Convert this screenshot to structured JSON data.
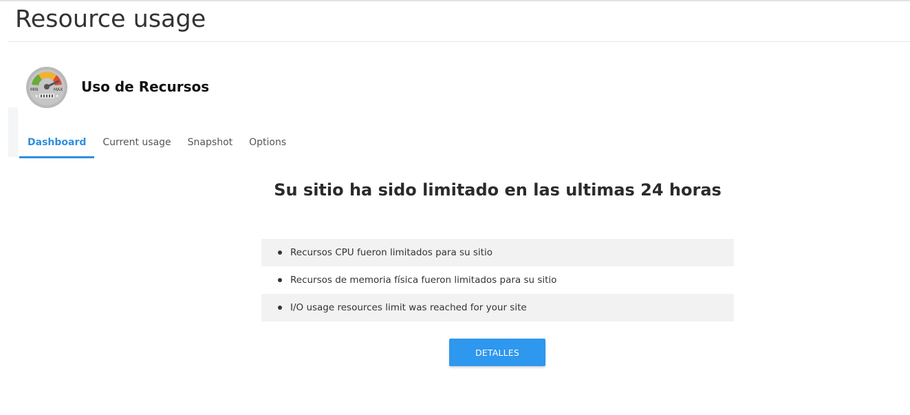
{
  "page": {
    "title": "Resource usage"
  },
  "plugin": {
    "name": "Uso de Recursos",
    "icon": "speedometer-gauge-icon",
    "icon_labels": {
      "min": "MIN",
      "max": "MAX"
    }
  },
  "tabs": [
    {
      "label": "Dashboard",
      "active": true
    },
    {
      "label": "Current usage",
      "active": false
    },
    {
      "label": "Snapshot",
      "active": false
    },
    {
      "label": "Options",
      "active": false
    }
  ],
  "dashboard": {
    "headline": "Su sitio ha sido limitado en las ultimas 24 horas",
    "limits": [
      "Recursos CPU fueron limitados para su sitio",
      "Recursos de memoria física fueron limitados para su sitio",
      "I/O usage resources limit was reached for your site"
    ],
    "details_button": "DETALLES"
  },
  "colors": {
    "accent": "#2f8fe0",
    "button": "#2e97ee",
    "row_stripe": "#f2f2f2"
  }
}
